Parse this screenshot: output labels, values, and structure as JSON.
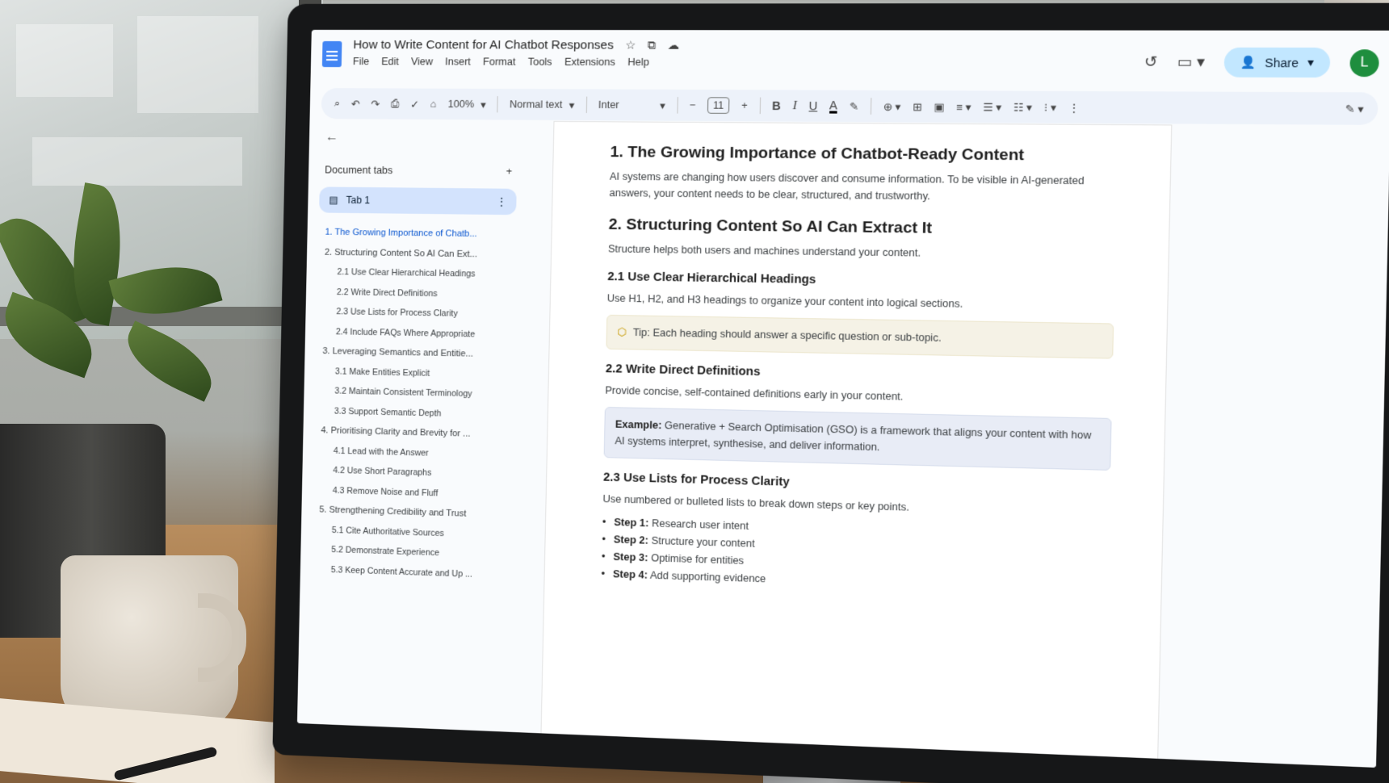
{
  "app": {
    "doc_title": "How to Write Content for AI Chatbot Responses",
    "menu": [
      "File",
      "Edit",
      "View",
      "Insert",
      "Format",
      "Tools",
      "Extensions",
      "Help"
    ],
    "share_label": "Share",
    "avatar_initial": "L"
  },
  "toolbar": {
    "zoom": "100%",
    "style": "Normal text",
    "font": "Inter",
    "font_size": "11",
    "bold": "B",
    "italic": "I",
    "underline": "U",
    "text_color": "A"
  },
  "sidebar": {
    "header": "Document tabs",
    "tab_label": "Tab 1",
    "outline": [
      {
        "text": "1. The Growing Importance of Chatb...",
        "level": 1,
        "active": true
      },
      {
        "text": "2. Structuring Content So AI Can Ext...",
        "level": 1
      },
      {
        "text": "2.1 Use Clear Hierarchical Headings",
        "level": 2
      },
      {
        "text": "2.2 Write Direct Definitions",
        "level": 2
      },
      {
        "text": "2.3 Use Lists for Process Clarity",
        "level": 2
      },
      {
        "text": "2.4 Include FAQs Where Appropriate",
        "level": 2
      },
      {
        "text": "3. Leveraging Semantics and Entitie...",
        "level": 1
      },
      {
        "text": "3.1 Make Entities Explicit",
        "level": 2
      },
      {
        "text": "3.2 Maintain Consistent Terminology",
        "level": 2
      },
      {
        "text": "3.3 Support Semantic Depth",
        "level": 2
      },
      {
        "text": "4. Prioritising Clarity and Brevity for ...",
        "level": 1
      },
      {
        "text": "4.1 Lead with the Answer",
        "level": 2
      },
      {
        "text": "4.2 Use Short Paragraphs",
        "level": 2
      },
      {
        "text": "4.3 Remove Noise and Fluff",
        "level": 2
      },
      {
        "text": "5. Strengthening Credibility and Trust",
        "level": 1
      },
      {
        "text": "5.1 Cite Authoritative Sources",
        "level": 2
      },
      {
        "text": "5.2 Demonstrate Experience",
        "level": 2
      },
      {
        "text": "5.3 Keep Content Accurate and Up ...",
        "level": 2
      }
    ]
  },
  "document": {
    "h1_1": "1.  The Growing Importance of Chatbot-Ready Content",
    "p1": "AI systems are changing how users discover and consume information. To be visible in AI-generated answers, your content needs to be clear, structured, and trustworthy.",
    "h1_2": "2.  Structuring Content So AI Can Extract It",
    "p2": "Structure helps both users and machines understand your content.",
    "h2_1": "2.1 Use Clear Hierarchical Headings",
    "p3": "Use H1, H2, and H3 headings to organize your content into logical sections.",
    "tip": "Tip: Each heading should answer a specific question or sub-topic.",
    "h2_2": "2.2 Write Direct Definitions",
    "p4": "Provide concise, self-contained definitions early in your content.",
    "example_label": "Example:",
    "example_text": " Generative + Search Optimisation (GSO) is a framework that aligns your content with how AI systems interpret, synthesise, and deliver information.",
    "h2_3": "2.3 Use Lists for Process Clarity",
    "p5": "Use numbered or bulleted lists to break down steps or key points.",
    "steps": [
      {
        "label": "Step 1:",
        "text": " Research user intent"
      },
      {
        "label": "Step 2:",
        "text": " Structure your content"
      },
      {
        "label": "Step 3:",
        "text": " Optimise for entities"
      },
      {
        "label": "Step 4:",
        "text": " Add supporting evidence"
      }
    ]
  },
  "colors": {
    "accent": "#0b57d0",
    "share_bg": "#c2e7ff",
    "tab_active_bg": "#d3e3fd",
    "avatar_bg": "#1e8e3e"
  }
}
